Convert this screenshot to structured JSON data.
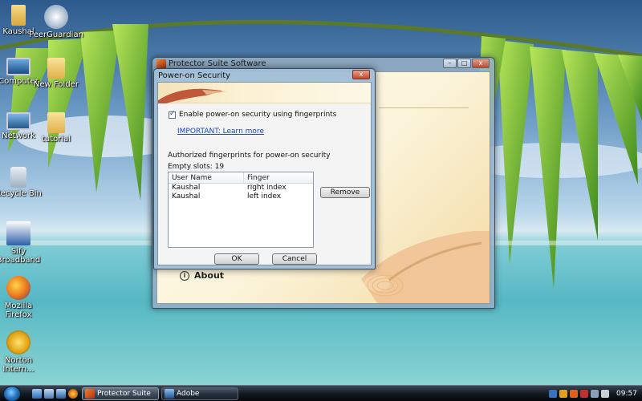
{
  "desktop": {
    "icons": [
      {
        "label": "Kaushal"
      },
      {
        "label": "PeerGuardian"
      },
      {
        "label": "Computer"
      },
      {
        "label": "New Folder"
      },
      {
        "label": "Network"
      },
      {
        "label": "tutorial"
      },
      {
        "label": "Recycle Bin"
      },
      {
        "label": "Sify Broadband"
      },
      {
        "label": "Mozilla Firefox"
      },
      {
        "label": "Norton Intern..."
      }
    ]
  },
  "app_window": {
    "title": "Protector Suite Software",
    "about_label": "About",
    "controls": {
      "minimize": "–",
      "maximize": "□",
      "close": "x"
    }
  },
  "dialog": {
    "title": "Power-on Security",
    "close": "x",
    "enable_checkbox": {
      "label": "Enable power-on security using fingerprints",
      "checked": true
    },
    "important_link": "IMPORTANT: Learn more",
    "authorized_label": "Authorized fingerprints for power-on security",
    "empty_slots": "Empty slots: 19",
    "table": {
      "columns": [
        "User Name",
        "Finger"
      ],
      "rows": [
        [
          "Kaushal",
          "right index"
        ],
        [
          "Kaushal",
          "left index"
        ]
      ]
    },
    "remove_label": "Remove",
    "ok_label": "OK",
    "cancel_label": "Cancel"
  },
  "taskbar": {
    "tasks": [
      {
        "label": "Protector Suite Soft...",
        "active": true
      },
      {
        "label": "Adobe Photoshop",
        "active": false
      }
    ],
    "clock": "09:57"
  },
  "colors": {
    "link": "#1a44c6",
    "taskbar": "#141b23",
    "close_button": "#c04a30"
  }
}
